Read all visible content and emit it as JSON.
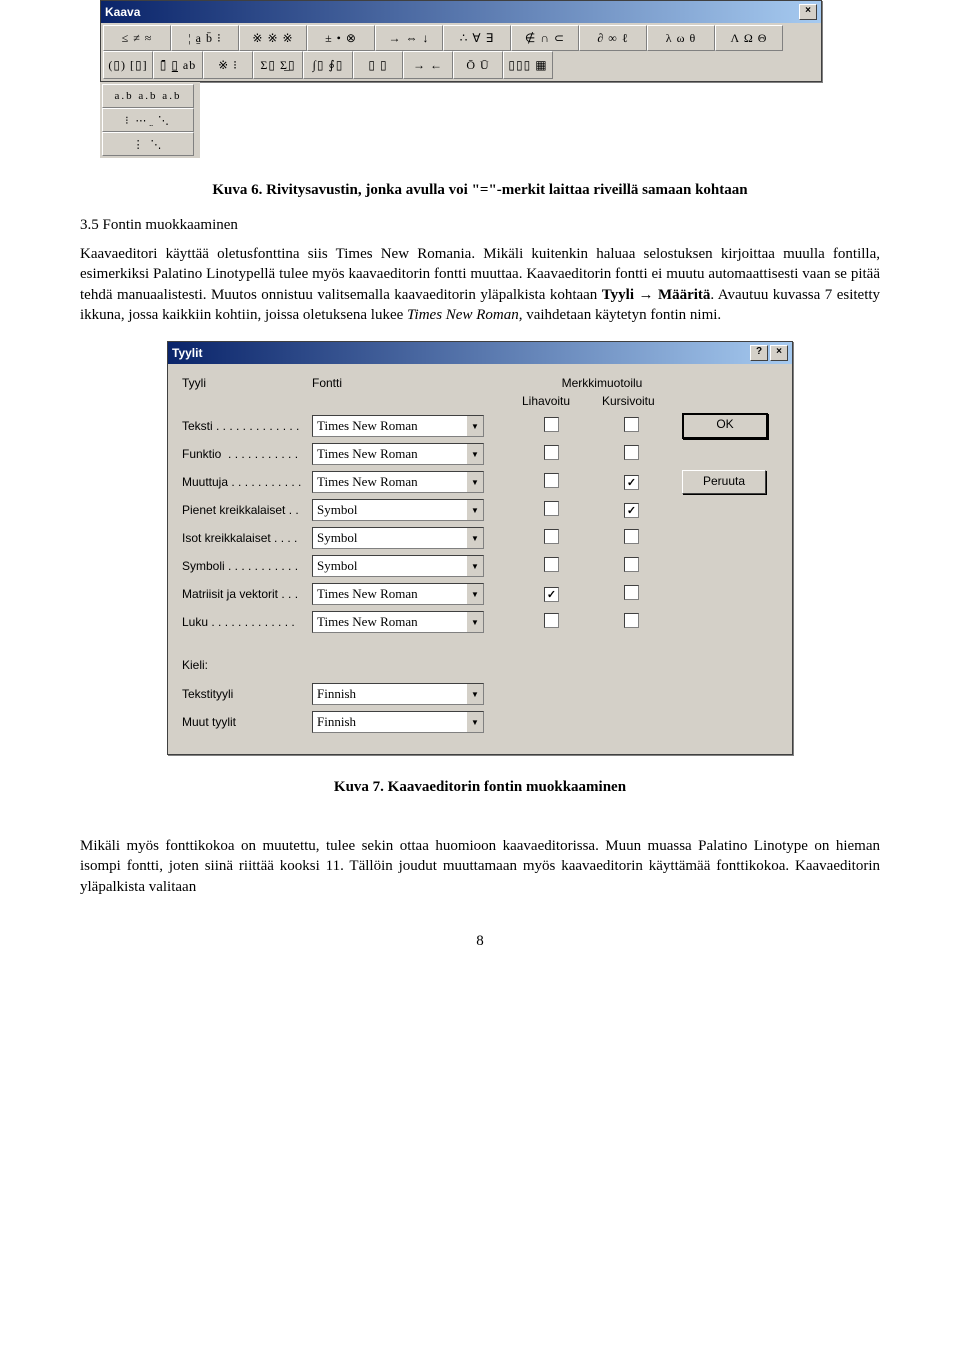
{
  "kaava": {
    "title": "Kaava",
    "close": "×",
    "row1": [
      "≤ ≠ ≈",
      "¦ a̱ b̄ ⁝",
      "※ ※ ※",
      "± • ⊗",
      "→ ⇔ ↓",
      "∴ ∀ ∃",
      "∉ ∩ ⊂",
      "∂ ∞ ℓ",
      "λ ω θ",
      "Λ Ω Θ"
    ],
    "row2": [
      "(▯) [▯]",
      "▯̄ ▯̲ ab",
      "※ ⁝",
      "Σ▯ Σ̲▯",
      "∫▯ ∮▯",
      "▯ ▯",
      "→ ←",
      "Ō Ū",
      "▯▯▯ ▦"
    ],
    "dots": [
      "a.b a.b a.b",
      "⁝ ⋯ ̤ ⋱",
      "⋮ ⋱"
    ]
  },
  "caption6": "Kuva 6. Rivitysavustin, jonka avulla voi \"=\"-merkit laittaa riveillä samaan kohtaan",
  "section35": "3.5  Fontin muokkaaminen",
  "para1": "Kaavaeditori käyttää oletusfonttina siis Times New Romania. Mikäli kuitenkin haluaa selostuksen kirjoittaa muulla fontilla, esimerkiksi Palatino Linotypellä tulee myös kaavaeditorin fontti muuttaa. Kaavaeditorin fontti ei muutu automaattisesti vaan se pitää tehdä manuaalistesti. Muutos onnistuu valitsemalla kaavaeditorin yläpalkista kohtaan ",
  "para1_bold1": "Tyyli",
  "para1_arrow": " → ",
  "para1_bold2": "Määritä",
  "para1_cont": ". Avautuu kuvassa 7 esitetty ikkuna, jossa kaikkiin kohtiin, joissa oletuksena lukee ",
  "para1_italic": "Times New Roman,",
  "para1_end": " vaihdetaan käytetyn fontin nimi.",
  "tyylit": {
    "title": "Tyylit",
    "help": "?",
    "close": "×",
    "h_tyyli": "Tyyli",
    "h_fontti": "Fontti",
    "h_merkki": "Merkkimuotoilu",
    "h_liha": "Lihavoitu",
    "h_kursi": "Kursivoitu",
    "ok": "OK",
    "cancel": "Peruuta",
    "rows": [
      {
        "label": "Teksti . . . . . . . . . . . . .",
        "font": "Times New Roman",
        "bold": false,
        "italic": false
      },
      {
        "label": "Funktio  . . . . . . . . . . .",
        "font": "Times New Roman",
        "bold": false,
        "italic": false
      },
      {
        "label": "Muuttuja . . . . . . . . . . .",
        "font": "Times New Roman",
        "bold": false,
        "italic": true
      },
      {
        "label": "Pienet kreikkalaiset . .",
        "font": "Symbol",
        "bold": false,
        "italic": true
      },
      {
        "label": "Isot kreikkalaiset . . . .",
        "font": "Symbol",
        "bold": false,
        "italic": false
      },
      {
        "label": "Symboli . . . . . . . . . . .",
        "font": "Symbol",
        "bold": false,
        "italic": false
      },
      {
        "label": "Matriisit ja vektorit . . .",
        "font": "Times New Roman",
        "bold": true,
        "italic": false
      },
      {
        "label": "Luku . . . . . . . . . . . . .",
        "font": "Times New Roman",
        "bold": false,
        "italic": false
      }
    ],
    "kieli_label": "Kieli:",
    "lang_rows": [
      {
        "label": "Tekstityyli",
        "value": "Finnish"
      },
      {
        "label": "Muut tyylit",
        "value": "Finnish"
      }
    ]
  },
  "caption7": "Kuva 7. Kaavaeditorin fontin muokkaaminen",
  "para2": "Mikäli myös fonttikokoa on muutettu, tulee sekin ottaa huomioon kaavaeditorissa. Muun muassa Palatino Linotype on hieman isompi fontti, joten siinä riittää kooksi 11. Tällöin joudut muuttamaan myös kaavaeditorin käyttämää fonttikokoa. Kaavaeditorin yläpalkista valitaan",
  "page_num": "8"
}
